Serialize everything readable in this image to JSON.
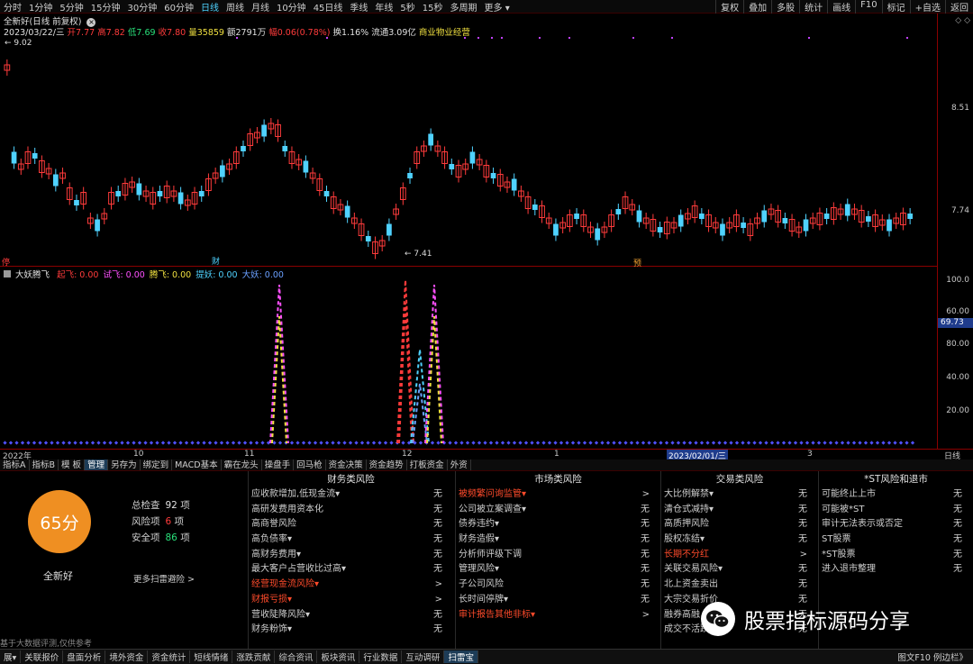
{
  "top_periods": [
    {
      "label": "分时",
      "active": false
    },
    {
      "label": "1分钟",
      "active": false
    },
    {
      "label": "5分钟",
      "active": false
    },
    {
      "label": "15分钟",
      "active": false
    },
    {
      "label": "30分钟",
      "active": false
    },
    {
      "label": "60分钟",
      "active": false
    },
    {
      "label": "日线",
      "active": true
    },
    {
      "label": "周线",
      "active": false
    },
    {
      "label": "月线",
      "active": false
    },
    {
      "label": "10分钟",
      "active": false
    },
    {
      "label": "45日线",
      "active": false
    },
    {
      "label": "季线",
      "active": false
    },
    {
      "label": "年线",
      "active": false
    },
    {
      "label": "5秒",
      "active": false
    },
    {
      "label": "15秒",
      "active": false
    },
    {
      "label": "多周期",
      "active": false
    },
    {
      "label": "更多 ▾",
      "active": false
    }
  ],
  "top_tools": [
    "复权",
    "叠加",
    "多股",
    "统计",
    "画线",
    "F10",
    "标记",
    "+自选",
    "返回"
  ],
  "main_chart": {
    "title": "全新好(日线 前复权)",
    "info": {
      "date": "2023/03/22/三",
      "open": "开7.77",
      "high": "高7.82",
      "low": "低7.69",
      "close": "收7.80",
      "volume": "量35859",
      "amount": "额2791万",
      "change": "幅0.06(0.78%)",
      "turnover": "换1.16%",
      "float": "流通3.09亿",
      "industry": "商业物业经营"
    },
    "price_labels": [
      "8.51",
      "7.74"
    ],
    "high_mark": "9.02",
    "low_mark": "7.41",
    "markers": [
      {
        "text": "停",
        "color": "#ff3b3b"
      },
      {
        "text": "财",
        "color": "#4fd2ff"
      },
      {
        "text": "预",
        "color": "#f0a030"
      }
    ],
    "colors": {
      "up": "#ff3b3b",
      "down": "#4fd2ff"
    }
  },
  "indicator": {
    "name": "大妖腾飞",
    "items": [
      {
        "label": "起飞: 0.00",
        "color": "#ff3b3b"
      },
      {
        "label": "试飞: 0.00",
        "color": "#ff50ff"
      },
      {
        "label": "腾飞: 0.00",
        "color": "#f0e040"
      },
      {
        "label": "提妖: 0.00",
        "color": "#4fd2ff"
      },
      {
        "label": "大妖: 0.00",
        "color": "#6aa0ff"
      }
    ],
    "axis_labels": [
      "100.0",
      "80.00",
      "60.00",
      "40.00",
      "20.00"
    ],
    "current_value": "69.73"
  },
  "date_axis": [
    "2022年",
    "10",
    "11",
    "12",
    "1",
    "2023/02/01/三",
    "3"
  ],
  "date_axis_right": "日线",
  "bottom_tabs": [
    {
      "label": "指标A",
      "active": false
    },
    {
      "label": "指标B",
      "active": false
    },
    {
      "label": "模 板",
      "active": false
    },
    {
      "label": "管理",
      "active": true
    },
    {
      "label": "另存为",
      "active": false
    },
    {
      "label": "绑定到",
      "active": false
    },
    {
      "label": "MACD基本",
      "active": false
    },
    {
      "label": "霸在龙头",
      "active": false
    },
    {
      "label": "操盘手",
      "active": false
    },
    {
      "label": "回马枪",
      "active": false
    },
    {
      "label": "资金决策",
      "active": false
    },
    {
      "label": "资金趋势",
      "active": false
    },
    {
      "label": "打板资金",
      "active": false
    },
    {
      "label": "外资",
      "active": false
    }
  ],
  "risk_summary": {
    "score": "65分",
    "stock_name": "全新好",
    "total_label": "总检查",
    "total_value": "92",
    "total_unit": "项",
    "risk_label": "风险项",
    "risk_value": "6",
    "risk_unit": "项",
    "safe_label": "安全项",
    "safe_value": "86",
    "safe_unit": "项",
    "more_link": "更多扫雷避险 >",
    "disclaimer": "基于大数据评测,仅供参考",
    "colors": {
      "score_bg": "#ef8f22",
      "risk": "#ff4b2b",
      "safe": "#29e07a"
    }
  },
  "risk_columns": [
    {
      "title": "财务类风险",
      "rows": [
        {
          "label": "应收款增加,低现金流▾",
          "value": "无",
          "hot": false
        },
        {
          "label": "高研发费用资本化",
          "value": "无",
          "hot": false
        },
        {
          "label": "高商誉风险",
          "value": "无",
          "hot": false
        },
        {
          "label": "高负债率▾",
          "value": "无",
          "hot": false
        },
        {
          "label": "高财务费用▾",
          "value": "无",
          "hot": false
        },
        {
          "label": "最大客户占营收比过高▾",
          "value": "无",
          "hot": false
        },
        {
          "label": "经营现金流风险▾",
          "value": ">",
          "hot": true
        },
        {
          "label": "财报亏损▾",
          "value": ">",
          "hot": true
        },
        {
          "label": "营收陡降风险▾",
          "value": "无",
          "hot": false
        },
        {
          "label": "财务粉饰▾",
          "value": "无",
          "hot": false
        }
      ]
    },
    {
      "title": "市场类风险",
      "rows": [
        {
          "label": "被频繁问询监管▾",
          "value": ">",
          "hot": true
        },
        {
          "label": "公司被立案调查▾",
          "value": "无",
          "hot": false
        },
        {
          "label": "债券违约▾",
          "value": "无",
          "hot": false
        },
        {
          "label": "财务造假▾",
          "value": "无",
          "hot": false
        },
        {
          "label": "分析师评级下调",
          "value": "无",
          "hot": false
        },
        {
          "label": "管理风险▾",
          "value": "无",
          "hot": false
        },
        {
          "label": "子公司风险",
          "value": "无",
          "hot": false
        },
        {
          "label": "长时间停牌▾",
          "value": "无",
          "hot": false
        },
        {
          "label": "审计报告其他非标▾",
          "value": ">",
          "hot": true
        }
      ]
    },
    {
      "title": "交易类风险",
      "rows": [
        {
          "label": "大比例解禁▾",
          "value": "无",
          "hot": false
        },
        {
          "label": "清仓式减持▾",
          "value": "无",
          "hot": false
        },
        {
          "label": "高质押风险",
          "value": "无",
          "hot": false
        },
        {
          "label": "股权冻结▾",
          "value": "无",
          "hot": false
        },
        {
          "label": "长期不分红",
          "value": ">",
          "hot": true
        },
        {
          "label": "关联交易风险▾",
          "value": "无",
          "hot": false
        },
        {
          "label": "北上资金卖出",
          "value": "无",
          "hot": false
        },
        {
          "label": "大宗交易折价",
          "value": "无",
          "hot": false
        },
        {
          "label": "融券高融",
          "value": "无",
          "hot": false
        },
        {
          "label": "成交不活跃▾",
          "value": "无",
          "hot": false
        }
      ]
    },
    {
      "title": "*ST风险和退市",
      "rows": [
        {
          "label": "可能终止上市",
          "value": "无",
          "hot": false
        },
        {
          "label": "可能被*ST",
          "value": "无",
          "hot": false
        },
        {
          "label": "审计无法表示或否定",
          "value": "无",
          "hot": false
        },
        {
          "label": "ST股票",
          "value": "无",
          "hot": false
        },
        {
          "label": "*ST股票",
          "value": "无",
          "hot": false
        },
        {
          "label": "进入退市整理",
          "value": "无",
          "hot": false
        }
      ]
    }
  ],
  "status_items": [
    {
      "label": "展▾",
      "active": false
    },
    {
      "label": "关联报价",
      "active": false
    },
    {
      "label": "盘面分析",
      "active": false
    },
    {
      "label": "境外资金",
      "active": false
    },
    {
      "label": "资金统计",
      "active": false
    },
    {
      "label": "短线情绪",
      "active": false
    },
    {
      "label": "涨跌贡献",
      "active": false
    },
    {
      "label": "综合资讯",
      "active": false
    },
    {
      "label": "板块资讯",
      "active": false
    },
    {
      "label": "行业数据",
      "active": false
    },
    {
      "label": "互动调研",
      "active": false
    },
    {
      "label": "扫雷宝",
      "active": true
    }
  ],
  "status_right": "图文F10 例边栏》",
  "watermark": "股票指标源码分享"
}
